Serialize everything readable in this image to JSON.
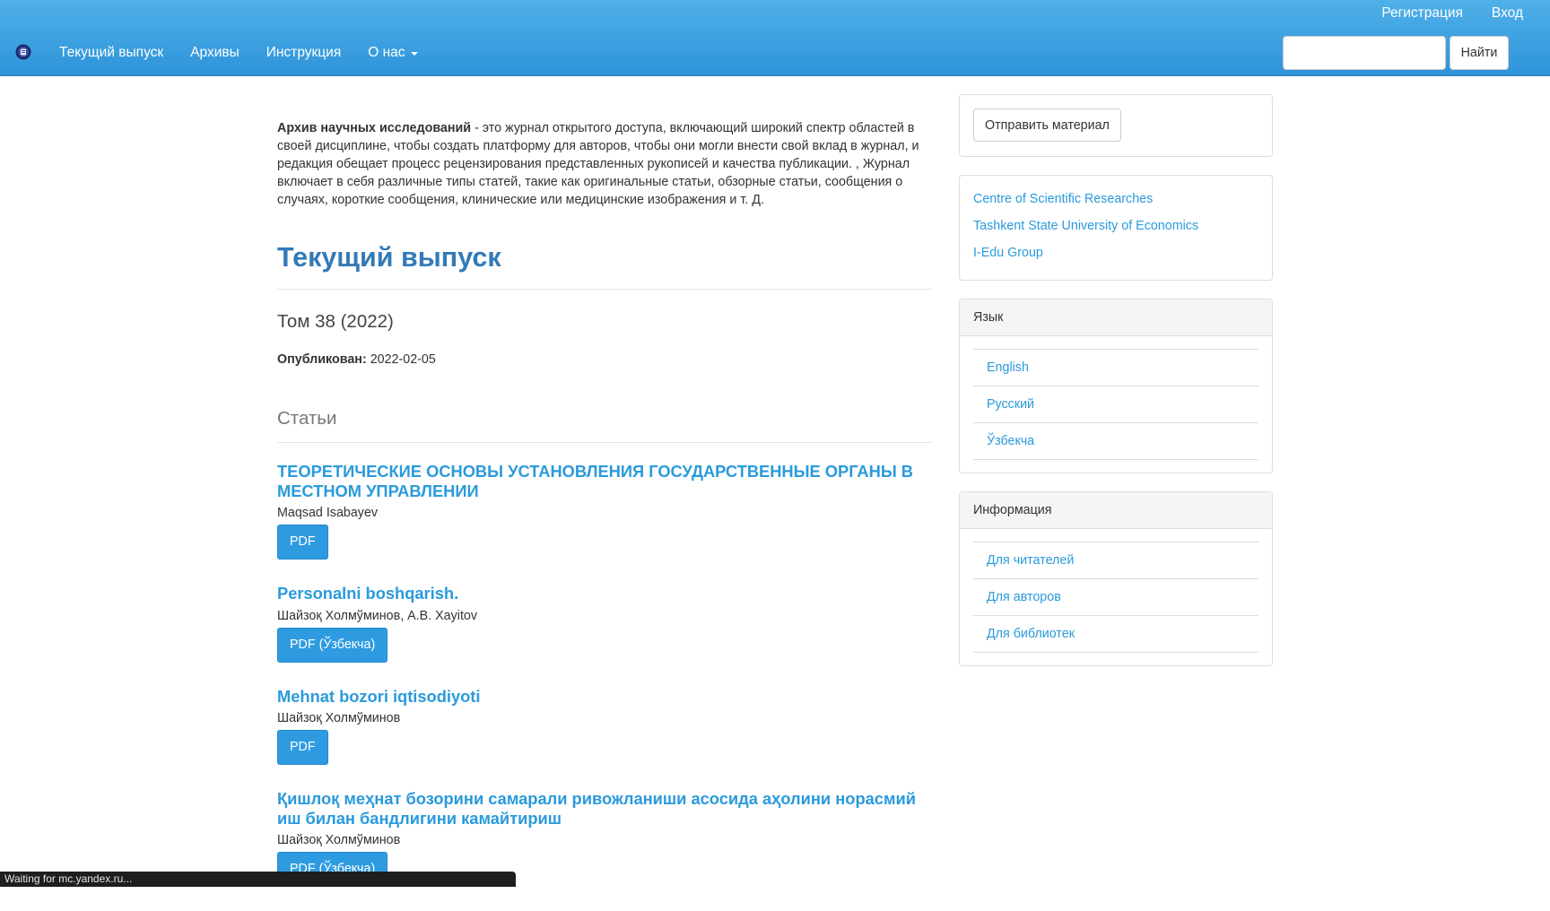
{
  "header": {
    "user_links": [
      "Регистрация",
      "Вход"
    ],
    "nav": [
      {
        "label": "Текущий выпуск"
      },
      {
        "label": "Архивы"
      },
      {
        "label": "Инструкция"
      },
      {
        "label": "О нас"
      }
    ],
    "search": {
      "placeholder": "",
      "button_label": "Найти"
    }
  },
  "main": {
    "intro_bold": "Архив научных исследований",
    "intro_text": " - это журнал открытого доступа, включающий широкий спектр областей в своей дисциплине, чтобы создать платформу для авторов, чтобы они могли внести свой вклад в журнал, и редакция обещает процесс рецензирования представленных рукописей и качества публикации. , Журнал включает в себя различные типы статей, такие как оригинальные статьи, обзорные статьи, сообщения о случаях, короткие сообщения, клинические или медицинские изображения и т. Д.",
    "page_title": "Текущий выпуск",
    "volume": "Том 38 (2022)",
    "published_label": "Опубликован:",
    "published_date": "2022-02-05",
    "section_title": "Статьи",
    "articles": [
      {
        "title": "ТЕОРЕТИЧЕСКИЕ ОСНОВЫ УСТАНОВЛЕНИЯ ГОСУДАРСТВЕННЫЕ ОРГАНЫ В МЕСТНОМ УПРАВЛЕНИИ",
        "authors": "Maqsad Isabayev",
        "button": "PDF"
      },
      {
        "title": "Personalni boshqarish.",
        "authors": "Шайзоқ Холмўминов, А.В. Xayitov",
        "button": "PDF (Ўзбекча)"
      },
      {
        "title": "Mehnat bozori iqtisodiyoti",
        "authors": "Шайзоқ Холмўминов",
        "button": "PDF"
      },
      {
        "title": "Қишлоқ меҳнат бозорини самарали ривожланиши асосида аҳолини норасмий иш билан бандлигини камайтириш",
        "authors": "Шайзоқ Холмўминов",
        "button": "PDF (Ўзбекча)"
      }
    ]
  },
  "sidebar": {
    "submit_label": "Отправить материал",
    "partner_links": [
      "Centre of Scientific Researches",
      "Tashkent State University of Economics",
      "I-Edu Group"
    ],
    "language": {
      "title": "Язык",
      "items": [
        "English",
        "Русский",
        "Ўзбекча"
      ]
    },
    "information": {
      "title": "Информация",
      "items": [
        "Для читателей",
        "Для авторов",
        "Для библиотек"
      ]
    }
  },
  "status_bar": "Waiting for mc.yandex.ru..."
}
